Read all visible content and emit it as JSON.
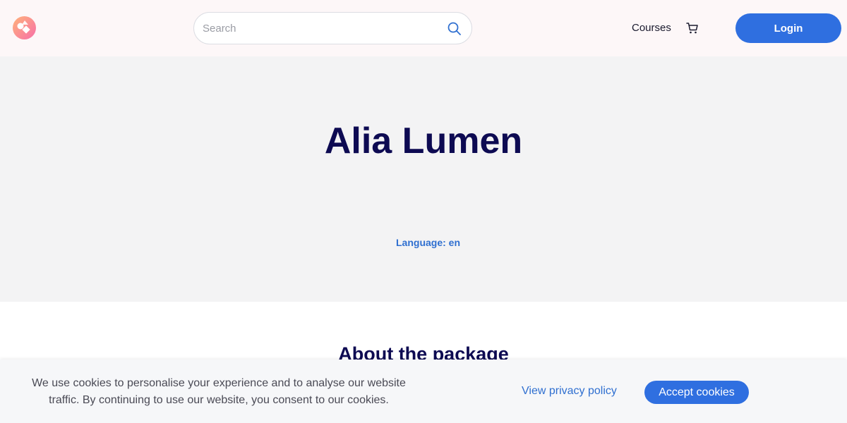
{
  "header": {
    "logo_icon": "brand-logo",
    "search": {
      "placeholder": "Search",
      "value": "",
      "icon": "search-icon"
    },
    "nav": {
      "courses_label": "Courses",
      "cart_icon": "cart-icon"
    },
    "login_label": "Login"
  },
  "hero": {
    "title": "Alia Lumen",
    "language": "Language: en"
  },
  "about": {
    "title": "About the package"
  },
  "cookie_banner": {
    "text": "We use cookies to personalise your experience and to analyse our website traffic. By continuing to use our website, you consent to our cookies.",
    "privacy_label": "View privacy policy",
    "accept_label": "Accept cookies"
  },
  "colors": {
    "accent": "#2f6fe0",
    "heading": "#0d0a52",
    "header_bg": "#fdf7f8",
    "hero_bg": "#f3f3f4"
  }
}
